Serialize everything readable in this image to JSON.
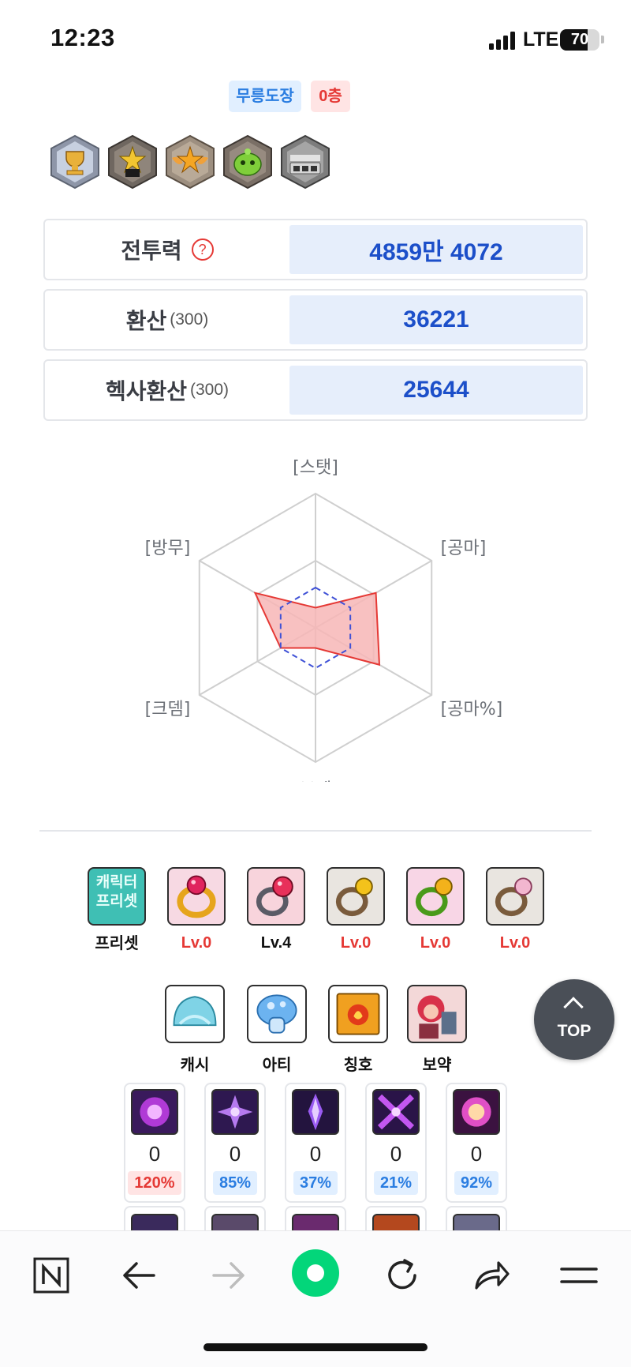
{
  "status_bar": {
    "time": "12:23",
    "network": "LTE",
    "battery": "70",
    "battery_level": 0.7
  },
  "dojo": {
    "label": "무릉도장",
    "floor": "0층"
  },
  "emblems": [
    {
      "icon": "trophy-emblem-icon"
    },
    {
      "icon": "star-emblem-icon"
    },
    {
      "icon": "winged-star-emblem-icon"
    },
    {
      "icon": "slime-emblem-icon"
    },
    {
      "icon": "helmet-emblem-icon"
    }
  ],
  "stats": {
    "combat_power": {
      "label": "전투력",
      "help": "?",
      "value": "4859만 4072"
    },
    "conversion": {
      "label": "환산",
      "sub": "(300)",
      "value": "36221"
    },
    "hexa_conversion": {
      "label": "헥사환산",
      "sub": "(300)",
      "value": "25644"
    }
  },
  "radar": {
    "axes": [
      "[스탯]",
      "[공마]",
      "[공마%]",
      "[보뎀]",
      "[크뎀]",
      "[방무]"
    ],
    "values": [
      0.15,
      0.52,
      0.55,
      0.15,
      0.3,
      0.52
    ],
    "reference": [
      0.3,
      0.3,
      0.3,
      0.3,
      0.3,
      0.3
    ],
    "fill_color": "#f7b6b6",
    "stroke_color": "#e53935",
    "reference_color": "#3f51d6"
  },
  "presets": [
    {
      "icon": "character-preset-icon",
      "caption": "프리셋",
      "icon_text": "캐릭터\n프리셋",
      "caption_color": "black"
    },
    {
      "icon": "ruby-ring-icon",
      "caption": "Lv.0",
      "caption_color": "red"
    },
    {
      "icon": "pink-gem-ring-icon",
      "caption": "Lv.4",
      "caption_color": "black"
    },
    {
      "icon": "gold-gem-ring-icon",
      "caption": "Lv.0",
      "caption_color": "red"
    },
    {
      "icon": "green-ring-icon",
      "caption": "Lv.0",
      "caption_color": "red"
    },
    {
      "icon": "pearl-ring-icon",
      "caption": "Lv.0",
      "caption_color": "red"
    }
  ],
  "secondary": [
    {
      "icon": "cash-hat-icon",
      "caption": "캐시"
    },
    {
      "icon": "mushroom-icon",
      "caption": "아티"
    },
    {
      "icon": "title-book-icon",
      "caption": "칭호"
    },
    {
      "icon": "potion-character-icon",
      "caption": "보약"
    }
  ],
  "top_button": {
    "label": "TOP"
  },
  "symbols": [
    {
      "icon": "purple-swirl-symbol-icon",
      "level": "0",
      "percent": "120%",
      "tone": "red"
    },
    {
      "icon": "violet-star-symbol-icon",
      "level": "0",
      "percent": "85%",
      "tone": "blue"
    },
    {
      "icon": "crystal-symbol-icon",
      "level": "0",
      "percent": "37%",
      "tone": "blue"
    },
    {
      "icon": "cross-blade-symbol-icon",
      "level": "0",
      "percent": "21%",
      "tone": "blue"
    },
    {
      "icon": "pink-glow-symbol-icon",
      "level": "0",
      "percent": "92%",
      "tone": "blue"
    }
  ],
  "bottom_nav": [
    {
      "icon": "naver-home-icon"
    },
    {
      "icon": "back-arrow-icon"
    },
    {
      "icon": "forward-arrow-icon"
    },
    {
      "icon": "green-circle-icon"
    },
    {
      "icon": "reload-icon"
    },
    {
      "icon": "share-icon"
    },
    {
      "icon": "menu-icon"
    }
  ]
}
